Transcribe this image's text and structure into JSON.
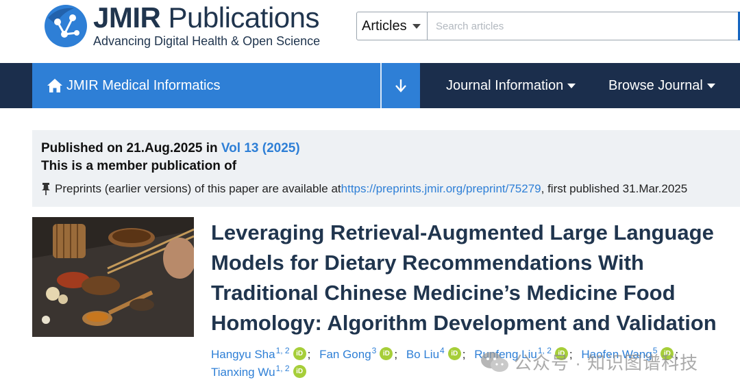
{
  "header": {
    "brand_bold": "JMIR",
    "brand_light": "Publications",
    "tagline": "Advancing Digital Health & Open Science"
  },
  "search": {
    "selected": "Articles",
    "placeholder": "Search articles"
  },
  "nav": {
    "journal": "JMIR Medical Informatics",
    "journal_info": "Journal Information",
    "browse": "Browse Journal"
  },
  "publication": {
    "published_prefix": "Published on 21.Aug.2025 in ",
    "volume": "Vol 13 (2025)",
    "member": "This is a member publication of",
    "preprint_prefix": "Preprints (earlier versions) of this paper are available at ",
    "preprint_url": "https://preprints.jmir.org/preprint/75279",
    "preprint_suffix": ", first published 31.Mar.2025"
  },
  "article": {
    "title": "Leveraging Retrieval-Augmented Large Language Models for Dietary Recommendations With Traditional Chinese Medicine’s Medicine Food Homology: Algorithm Development and Validation",
    "authors": [
      {
        "name": "Hangyu Sha",
        "aff": "1, 2"
      },
      {
        "name": "Fan Gong",
        "aff": "3"
      },
      {
        "name": "Bo Liu",
        "aff": "4"
      },
      {
        "name": "Runfeng Liu",
        "aff": "1, 2"
      },
      {
        "name": "Haofen Wang",
        "aff": "5"
      },
      {
        "name": "Tianxing Wu",
        "aff": "1, 2"
      }
    ],
    "orcid_label": "iD",
    "separator": ";"
  },
  "watermark": {
    "text": "公众号 · 知识图谱科技"
  },
  "colors": {
    "navy": "#1b2e4c",
    "accent_blue": "#2e7fd6",
    "title_navy": "#20354e",
    "orcid_green": "#a6ce39"
  },
  "icons": [
    "jmir-logo-icon",
    "home-icon",
    "arrow-down-icon",
    "caret-down-icon",
    "pushpin-icon",
    "orcid-icon",
    "wechat-icon"
  ]
}
